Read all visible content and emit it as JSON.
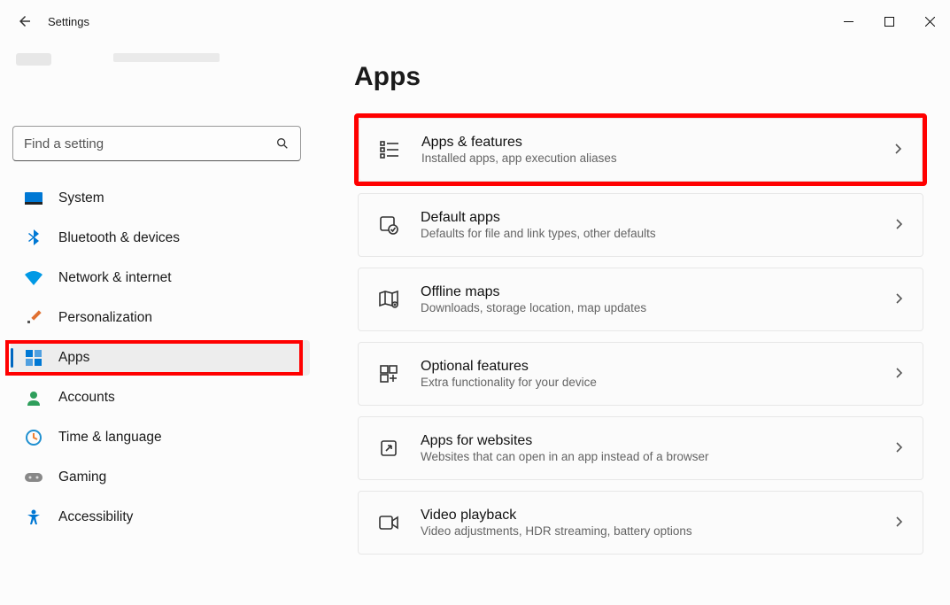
{
  "titlebar": {
    "label": "Settings"
  },
  "search": {
    "placeholder": "Find a setting"
  },
  "sidebar": {
    "items": [
      {
        "label": "System",
        "icon": "system"
      },
      {
        "label": "Bluetooth & devices",
        "icon": "bluetooth"
      },
      {
        "label": "Network & internet",
        "icon": "network"
      },
      {
        "label": "Personalization",
        "icon": "personalization"
      },
      {
        "label": "Apps",
        "icon": "apps",
        "active": true,
        "highlight": true
      },
      {
        "label": "Accounts",
        "icon": "accounts"
      },
      {
        "label": "Time & language",
        "icon": "time"
      },
      {
        "label": "Gaming",
        "icon": "gaming"
      },
      {
        "label": "Accessibility",
        "icon": "accessibility"
      }
    ]
  },
  "page": {
    "title": "Apps",
    "cards": [
      {
        "title": "Apps & features",
        "desc": "Installed apps, app execution aliases",
        "icon": "apps-features",
        "highlight": true
      },
      {
        "title": "Default apps",
        "desc": "Defaults for file and link types, other defaults",
        "icon": "default-apps"
      },
      {
        "title": "Offline maps",
        "desc": "Downloads, storage location, map updates",
        "icon": "offline-maps"
      },
      {
        "title": "Optional features",
        "desc": "Extra functionality for your device",
        "icon": "optional-features"
      },
      {
        "title": "Apps for websites",
        "desc": "Websites that can open in an app instead of a browser",
        "icon": "apps-websites"
      },
      {
        "title": "Video playback",
        "desc": "Video adjustments, HDR streaming, battery options",
        "icon": "video-playback"
      }
    ]
  }
}
